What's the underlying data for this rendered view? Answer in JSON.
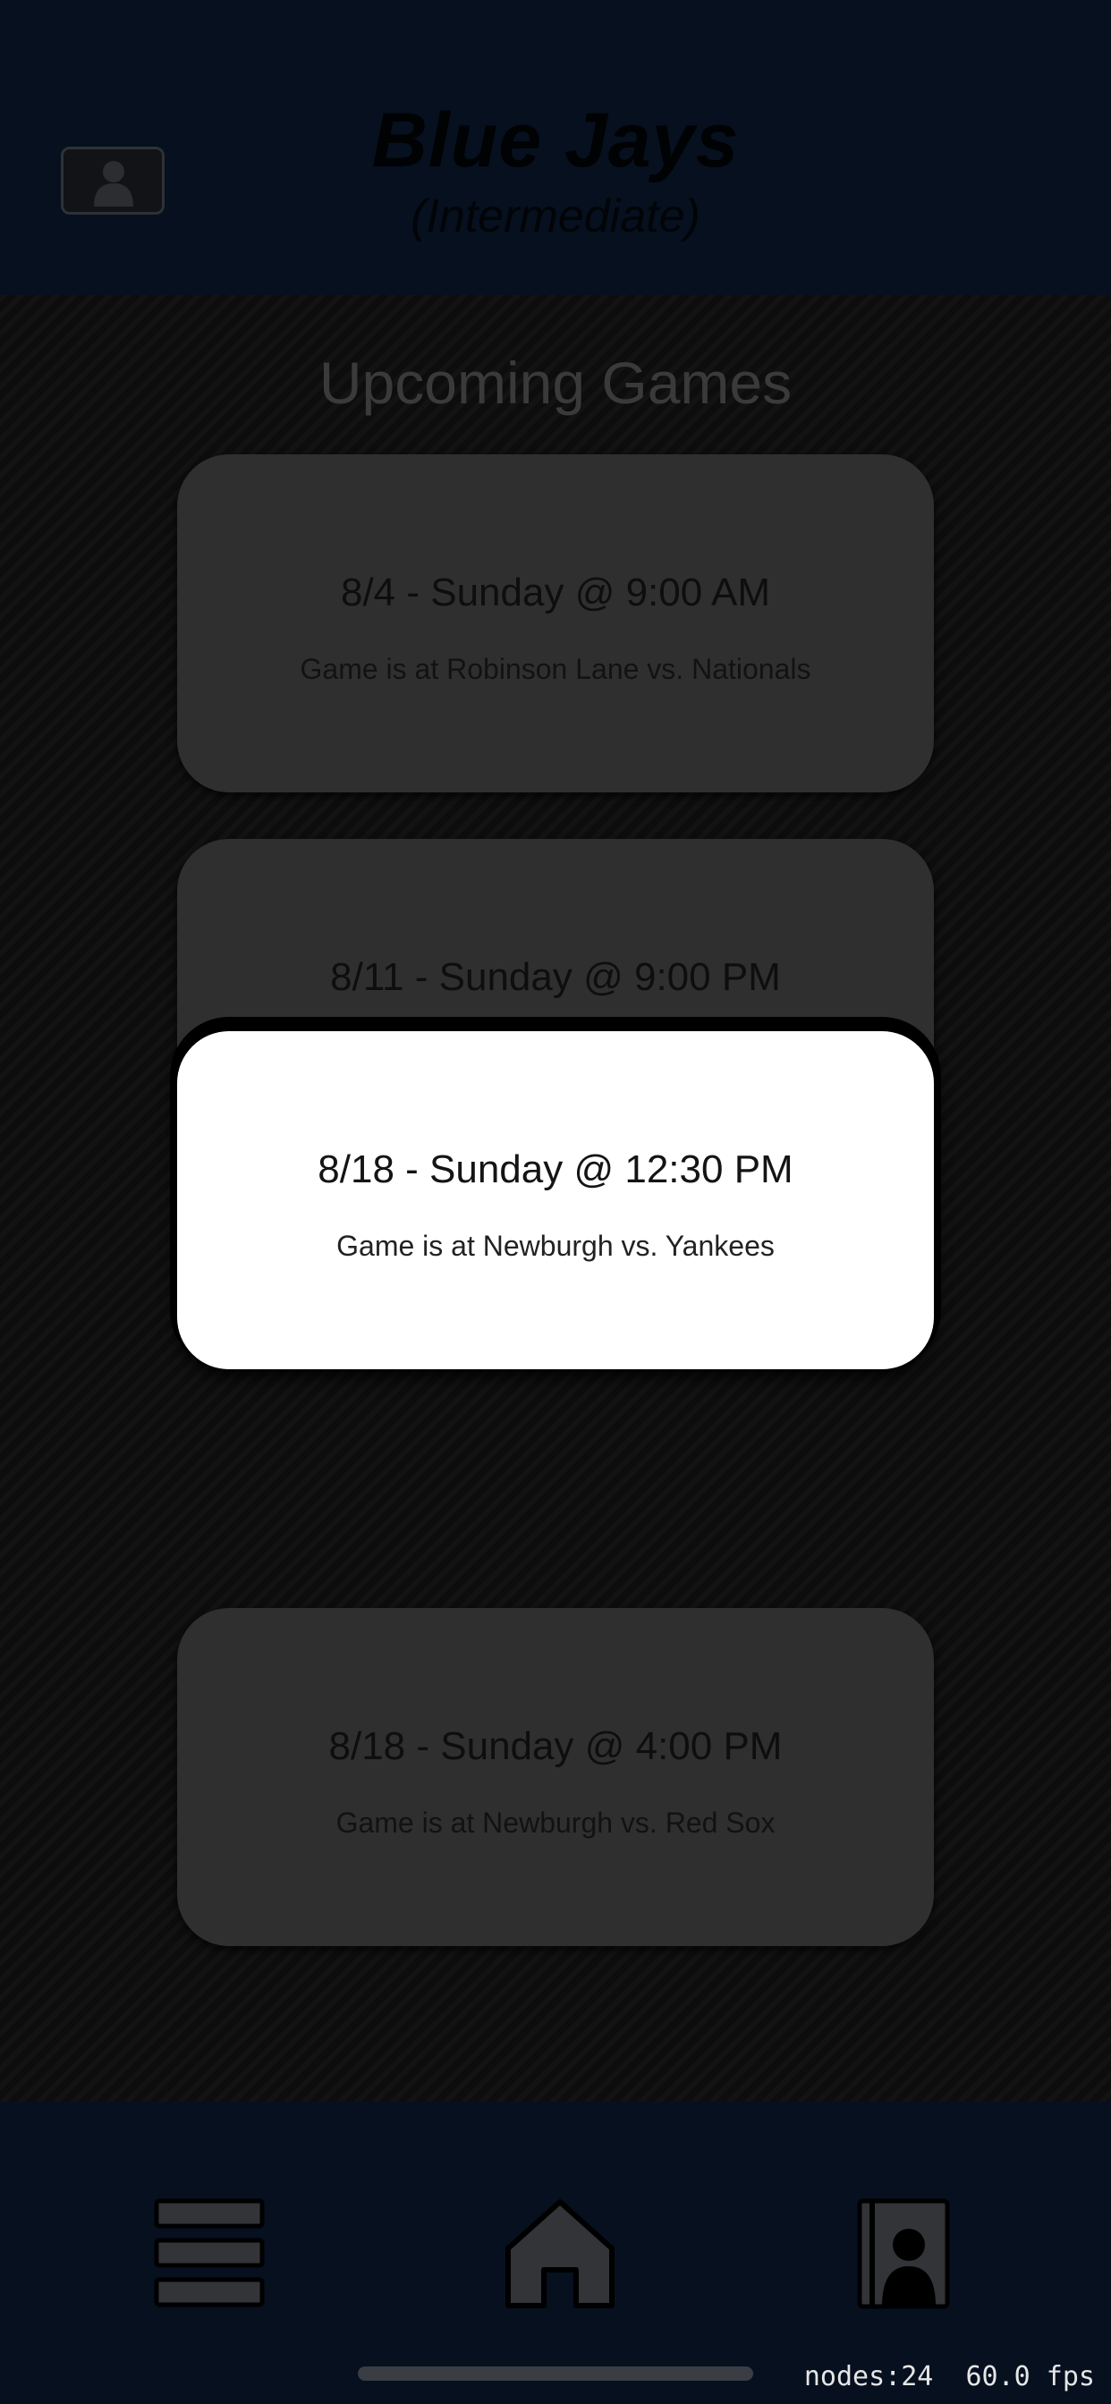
{
  "header": {
    "team_name": "Blue Jays",
    "team_level": "(Intermediate)"
  },
  "main": {
    "section_title": "Upcoming Games",
    "games": [
      {
        "date": "8/4 - Sunday @ 9:00 AM",
        "location": "Game is at Robinson Lane vs. Nationals"
      },
      {
        "date": "8/11 - Sunday @ 9:00 PM",
        "location": ""
      },
      {
        "date": "8/18 - Sunday @ 12:30 PM",
        "location": "Game is at Newburgh vs. Yankees"
      },
      {
        "date": "8/18 - Sunday @ 4:00 PM",
        "location": "Game is at Newburgh vs. Red Sox"
      }
    ]
  },
  "tabbar": {
    "items": [
      {
        "icon": "menu-icon"
      },
      {
        "icon": "home-icon"
      },
      {
        "icon": "contacts-icon"
      }
    ]
  },
  "debug": {
    "nodes": "nodes:24",
    "fps": "60.0 fps"
  },
  "colors": {
    "header_bg": "#06101f",
    "card_bg": "#2f2f30",
    "active_card_bg": "#ffffff"
  }
}
